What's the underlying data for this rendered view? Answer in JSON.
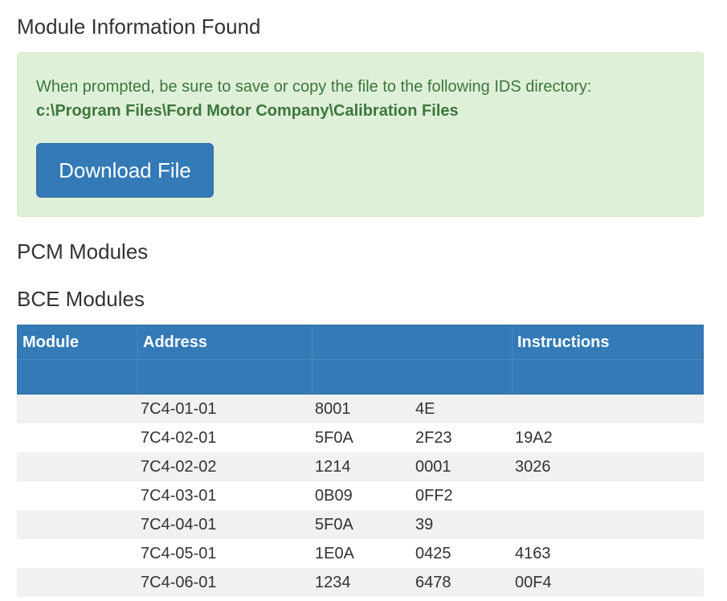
{
  "headings": {
    "module_info": "Module Information Found",
    "pcm": "PCM Modules",
    "bce": "BCE Modules"
  },
  "alert": {
    "message": "When prompted, be sure to save or copy the file to the following IDS directory:",
    "path": "c:\\Program Files\\Ford Motor Company\\Calibration Files",
    "download_label": "Download File"
  },
  "colors": {
    "alert_bg": "#dff0d8",
    "alert_text": "#3c763d",
    "primary": "#337ab7"
  },
  "table": {
    "headers": {
      "module": "Module",
      "address": "Address",
      "blank": "",
      "instructions": "Instructions"
    },
    "rows": [
      [
        "",
        "7C4-01-01",
        "8001",
        "4E",
        ""
      ],
      [
        "",
        "7C4-02-01",
        "5F0A",
        "2F23",
        "19A2"
      ],
      [
        "",
        "7C4-02-02",
        "1214",
        "0001",
        "3026"
      ],
      [
        "",
        "7C4-03-01",
        "0B09",
        "0FF2",
        ""
      ],
      [
        "",
        "7C4-04-01",
        "5F0A",
        "39",
        ""
      ],
      [
        "",
        "7C4-05-01",
        "1E0A",
        "0425",
        "4163"
      ],
      [
        "",
        "7C4-06-01",
        "1234",
        "6478",
        "00F4"
      ]
    ]
  }
}
